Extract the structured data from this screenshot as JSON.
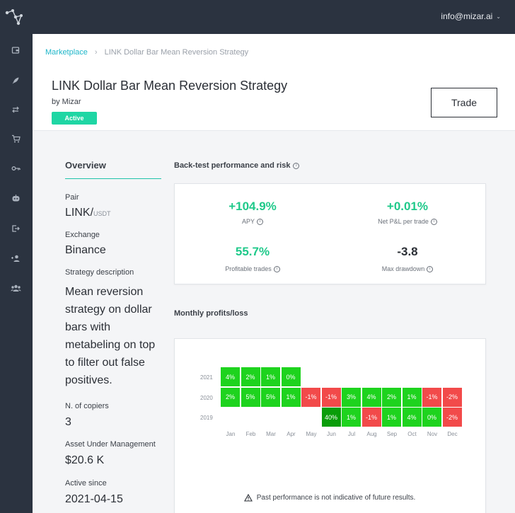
{
  "topbar": {
    "user_email": "info@mizar.ai"
  },
  "sidebar": {
    "items": [
      {
        "icon": "wallet-icon"
      },
      {
        "icon": "rocket-icon"
      },
      {
        "icon": "exchange-icon"
      },
      {
        "icon": "cart-icon"
      },
      {
        "icon": "key-icon"
      },
      {
        "icon": "robot-icon"
      },
      {
        "icon": "logout-icon"
      },
      {
        "icon": "user-add-icon"
      },
      {
        "icon": "users-icon"
      }
    ]
  },
  "breadcrumb": {
    "root": "Marketplace",
    "current": "LINK Dollar Bar Mean Reversion Strategy"
  },
  "header": {
    "title": "LINK Dollar Bar Mean Reversion Strategy",
    "byline": "by Mizar",
    "status": "Active",
    "trade_label": "Trade"
  },
  "overview": {
    "title": "Overview",
    "pair_label": "Pair",
    "pair_base": "LINK/",
    "pair_quote": "USDT",
    "exchange_label": "Exchange",
    "exchange": "Binance",
    "description_label": "Strategy description",
    "description": "Mean reversion strategy on dollar bars with metabeling on top to filter out false positives.",
    "copiers_label": "N. of copiers",
    "copiers": "3",
    "aum_label": "Asset Under Management",
    "aum": "$20.6 K",
    "active_since_label": "Active since",
    "active_since": "2021-04-15"
  },
  "backtest": {
    "title": "Back-test performance and risk",
    "metrics": [
      {
        "value": "+104.9%",
        "label": "APY",
        "color": "#1fc98a"
      },
      {
        "value": "+0.01%",
        "label": "Net P&L per trade",
        "color": "#1fc98a"
      },
      {
        "value": "55.7%",
        "label": "Profitable trades",
        "color": "#1fc98a"
      },
      {
        "value": "-3.8",
        "label": "Max drawdown",
        "color": "#2b2f36"
      }
    ]
  },
  "monthly": {
    "title": "Monthly profits/loss",
    "disclaimer": "Past performance is not indicative of future results.",
    "colors": {
      "positive": "#1ed31e",
      "negative": "#f24a4a",
      "strong": "#0a9d0a"
    }
  },
  "chart_data": {
    "type": "heatmap",
    "title": "Monthly profits/loss",
    "x": [
      "Jan",
      "Feb",
      "Mar",
      "Apr",
      "May",
      "Jun",
      "Jul",
      "Aug",
      "Sep",
      "Oct",
      "Nov",
      "Dec"
    ],
    "y": [
      "2021",
      "2020",
      "2019"
    ],
    "values": [
      [
        "4%",
        "2%",
        "1%",
        "0%",
        null,
        null,
        null,
        null,
        null,
        null,
        null,
        null
      ],
      [
        "2%",
        "5%",
        "5%",
        "1%",
        "-1%",
        "-1%",
        "3%",
        "4%",
        "2%",
        "1%",
        "-1%",
        "-2%"
      ],
      [
        null,
        null,
        null,
        null,
        null,
        "40%",
        "1%",
        "-1%",
        "1%",
        "4%",
        "0%",
        "-2%"
      ]
    ]
  }
}
